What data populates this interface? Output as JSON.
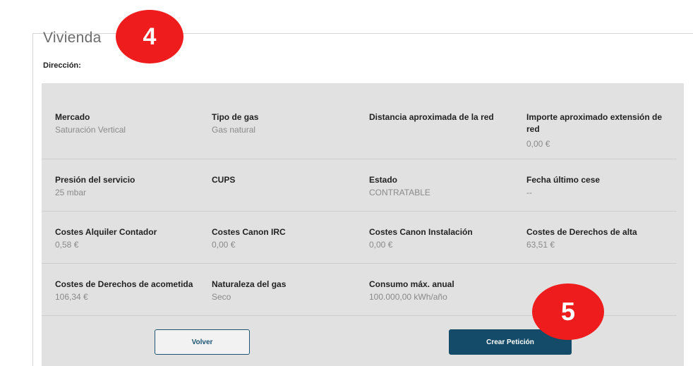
{
  "section": {
    "title": "Vivienda",
    "address_label": "Dirección:"
  },
  "rows": [
    [
      {
        "label": "Mercado",
        "value": "Saturación Vertical"
      },
      {
        "label": "Tipo de gas",
        "value": "Gas natural"
      },
      {
        "label": "Distancia aproximada de la red",
        "value": ""
      },
      {
        "label": "Importe aproximado extensión de red",
        "value": "0,00 €"
      }
    ],
    [
      {
        "label": "Presión del servicio",
        "value": "25 mbar"
      },
      {
        "label": "CUPS",
        "value": ""
      },
      {
        "label": "Estado",
        "value": "CONTRATABLE"
      },
      {
        "label": "Fecha último cese",
        "value": "--"
      }
    ],
    [
      {
        "label": "Costes Alquiler Contador",
        "value": "0,58 €"
      },
      {
        "label": "Costes Canon IRC",
        "value": "0,00 €"
      },
      {
        "label": "Costes Canon Instalación",
        "value": "0,00 €"
      },
      {
        "label": "Costes de Derechos de alta",
        "value": "63,51 €"
      }
    ],
    [
      {
        "label": "Costes de Derechos de acometida",
        "value": "106,34 €"
      },
      {
        "label": "Naturaleza del gas",
        "value": "Seco"
      },
      {
        "label": "Consumo máx. anual",
        "value": "100.000,00 kWh/año"
      }
    ]
  ],
  "buttons": {
    "back": "Volver",
    "create": "Crear Petición"
  },
  "annotations": {
    "badge_a": "4",
    "badge_b": "5",
    "color": "#ee1c1c"
  },
  "colors": {
    "panel_bg": "#e1e1e1",
    "primary": "#134b69"
  }
}
